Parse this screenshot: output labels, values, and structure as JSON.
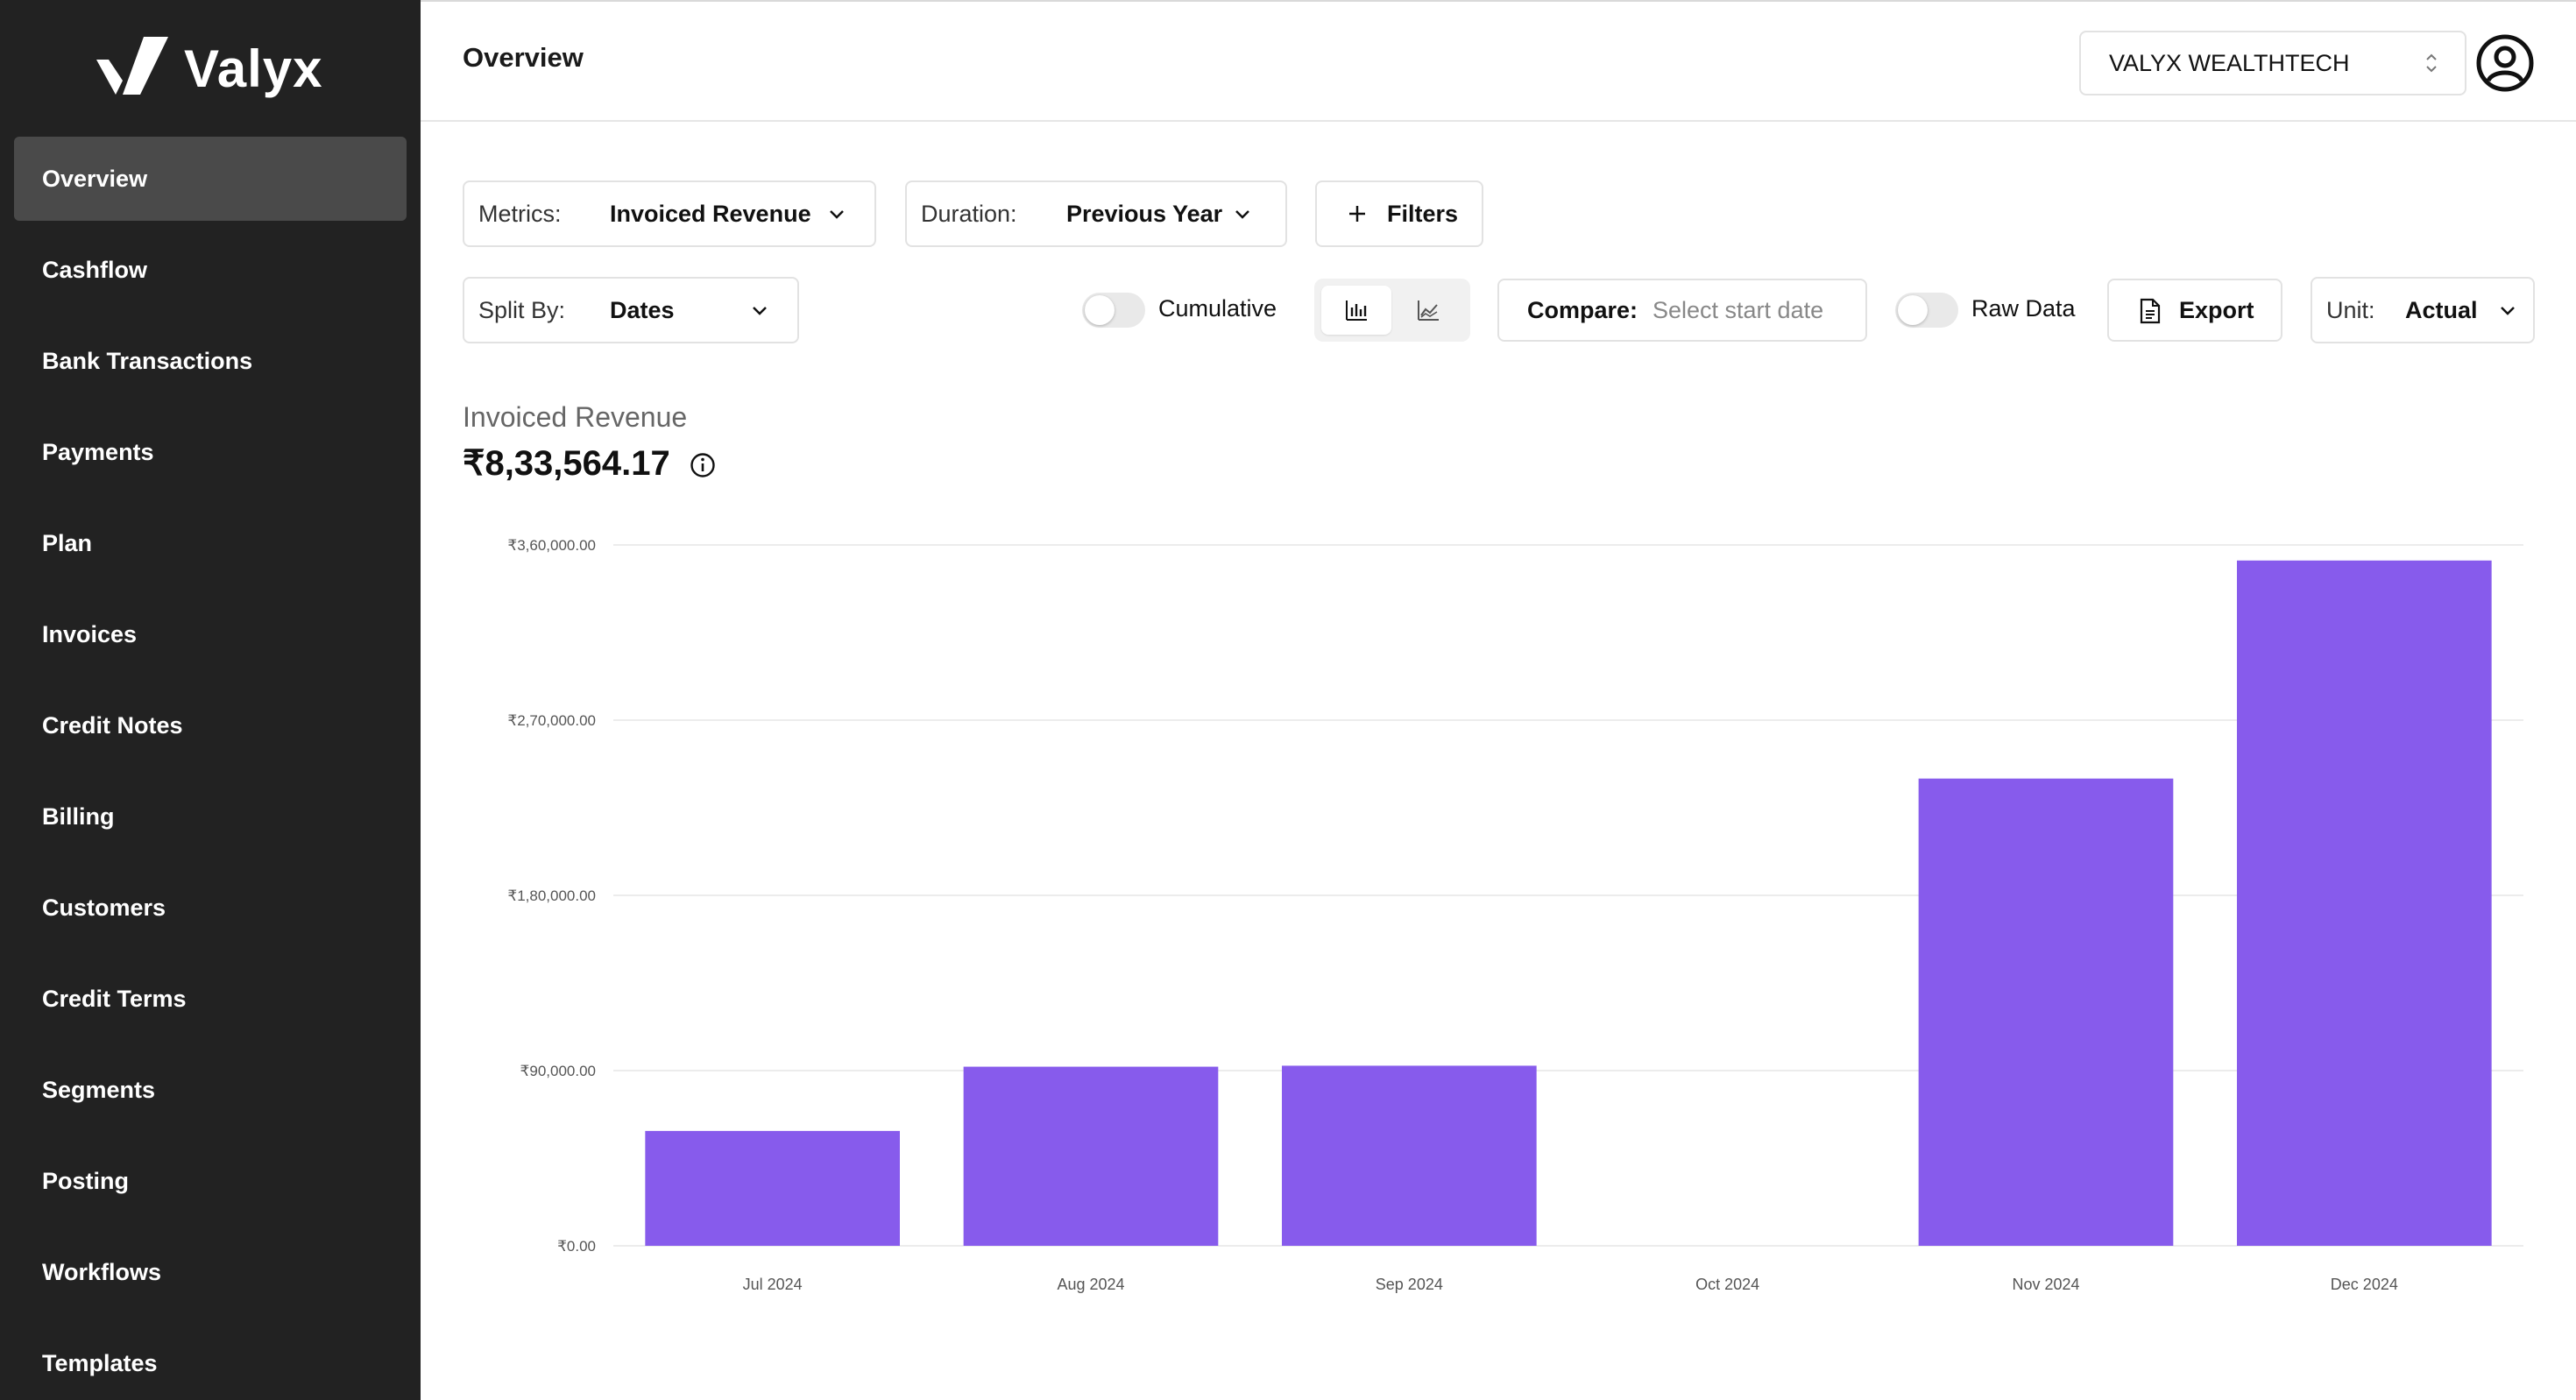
{
  "app": {
    "name": "Valyx"
  },
  "sidebar": {
    "items": [
      {
        "label": "Overview",
        "active": true
      },
      {
        "label": "Cashflow"
      },
      {
        "label": "Bank Transactions"
      },
      {
        "label": "Payments"
      },
      {
        "label": "Plan"
      },
      {
        "label": "Invoices"
      },
      {
        "label": "Credit Notes"
      },
      {
        "label": "Billing"
      },
      {
        "label": "Customers"
      },
      {
        "label": "Credit Terms"
      },
      {
        "label": "Segments"
      },
      {
        "label": "Posting"
      },
      {
        "label": "Workflows"
      },
      {
        "label": "Templates"
      }
    ]
  },
  "header": {
    "title": "Overview",
    "org": "VALYX WEALTHTECH",
    "icons": {
      "org_chevron": "chevron-up-down-icon",
      "account": "user-circle-icon"
    }
  },
  "controls": {
    "metrics": {
      "label": "Metrics:",
      "value": "Invoiced Revenue"
    },
    "duration": {
      "label": "Duration:",
      "value": "Previous Year"
    },
    "filters": {
      "label": "Filters",
      "icon": "plus-icon"
    },
    "split_by": {
      "label": "Split By:",
      "value": "Dates"
    },
    "cumulative": {
      "label": "Cumulative",
      "on": false
    },
    "chart_type": {
      "options": [
        "bar-chart-icon",
        "line-chart-icon"
      ],
      "selected": "bar-chart-icon"
    },
    "compare": {
      "label": "Compare:",
      "placeholder": "Select start date"
    },
    "raw_data": {
      "label": "Raw Data",
      "on": false
    },
    "export": {
      "label": "Export",
      "icon": "file-export-icon"
    },
    "unit": {
      "label": "Unit:",
      "value": "Actual"
    }
  },
  "summary": {
    "label": "Invoiced Revenue",
    "value": "₹8,33,564.17",
    "icon": "info-icon"
  },
  "colors": {
    "bar": "#875bec",
    "sidebar": "#222222",
    "sidebar_active": "#4a4a4a"
  },
  "chart_data": {
    "type": "bar",
    "categories": [
      "Jul 2024",
      "Aug 2024",
      "Sep 2024",
      "Oct 2024",
      "Nov 2024",
      "Dec 2024"
    ],
    "values": [
      59000,
      92000,
      92500,
      0,
      240000,
      352000
    ],
    "ylim": [
      0,
      360000
    ],
    "yticks": [
      0,
      90000,
      180000,
      270000,
      360000
    ],
    "ytick_labels": [
      "₹0.00",
      "₹90,000.00",
      "₹1,80,000.00",
      "₹2,70,000.00",
      "₹3,60,000.00"
    ],
    "grid": true,
    "legend": "none"
  }
}
